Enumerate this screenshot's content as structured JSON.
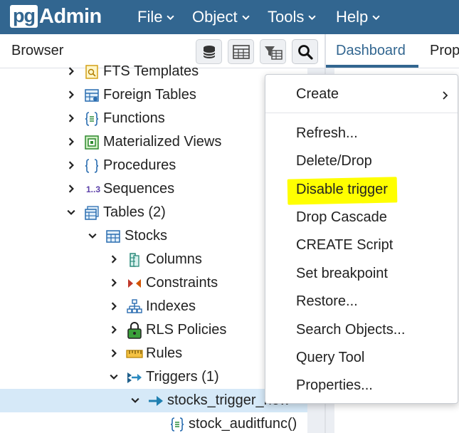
{
  "app": {
    "logo_pg": "pg",
    "logo_admin": "Admin",
    "menus": [
      "File",
      "Object",
      "Tools",
      "Help"
    ]
  },
  "browser": {
    "title": "Browser",
    "toolbar": [
      "database-icon",
      "table-grid-icon",
      "filter-table-icon",
      "search-icon"
    ]
  },
  "tabs": {
    "dashboard": "Dashboard",
    "properties_partial": "Prop"
  },
  "tree": [
    {
      "label": "FTS Templates",
      "icon": "fts-templates-icon"
    },
    {
      "label": "Foreign Tables",
      "icon": "foreign-tables-icon"
    },
    {
      "label": "Functions",
      "icon": "functions-icon"
    },
    {
      "label": "Materialized Views",
      "icon": "materialized-views-icon"
    },
    {
      "label": "Procedures",
      "icon": "procedures-icon"
    },
    {
      "label": "Sequences",
      "icon": "sequences-icon",
      "icon_text": "1..3"
    },
    {
      "label": "Tables (2)",
      "icon": "tables-icon"
    },
    {
      "label": "Stocks",
      "icon": "table-icon"
    },
    {
      "label": "Columns",
      "icon": "columns-icon"
    },
    {
      "label": "Constraints",
      "icon": "constraints-icon"
    },
    {
      "label": "Indexes",
      "icon": "indexes-icon"
    },
    {
      "label": "RLS Policies",
      "icon": "lock-icon"
    },
    {
      "label": "Rules",
      "icon": "rules-icon"
    },
    {
      "label": "Triggers (1)",
      "icon": "triggers-icon"
    },
    {
      "label": "stocks_trigger_new",
      "icon": "trigger-arrow-icon"
    },
    {
      "label": "stock_auditfunc()",
      "icon": "function-icon"
    }
  ],
  "context_menu": {
    "create": "Create",
    "items": [
      "Refresh...",
      "Delete/Drop",
      "Disable trigger",
      "Drop Cascade",
      "CREATE Script",
      "Set breakpoint",
      "Restore...",
      "Search Objects...",
      "Query Tool",
      "Properties..."
    ]
  },
  "colors": {
    "navbar": "#326690",
    "selected_row": "#d6e9f8",
    "highlight": "#ffff00"
  }
}
